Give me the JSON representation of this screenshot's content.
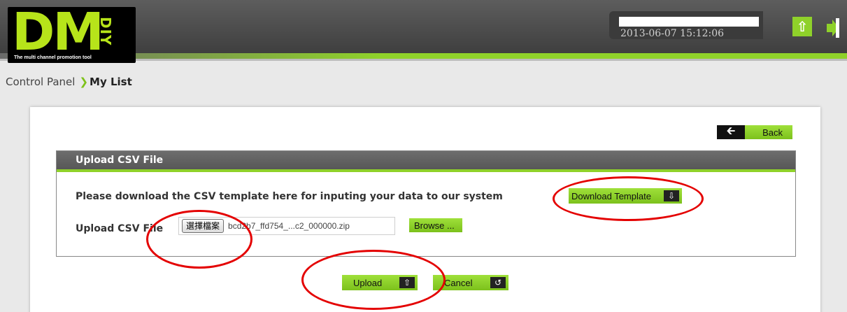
{
  "header": {
    "logo_text": "DM",
    "logo_diy": "DIY",
    "tagline": "The multi channel promotion tool",
    "datetime": "2013-06-07 15:12:06"
  },
  "breadcrumb": {
    "root": "Control Panel",
    "current": "My List"
  },
  "panel": {
    "back_label": "Back",
    "section_title": "Upload CSV File",
    "instruction": "Please download the CSV template here for inputing your data to our system",
    "download_label": "Download Template",
    "file_label": "Upload CSV File",
    "choose_file_label": "選擇檔案",
    "file_name": "bcd2b7_ffd754_...c2_000000.zip",
    "browse_label": "Browse ...",
    "upload_label": "Upload",
    "cancel_label": "Cancel"
  },
  "colors": {
    "accent": "#8fd12a",
    "header": "#4a4a4a",
    "highlight": "#e40000"
  }
}
